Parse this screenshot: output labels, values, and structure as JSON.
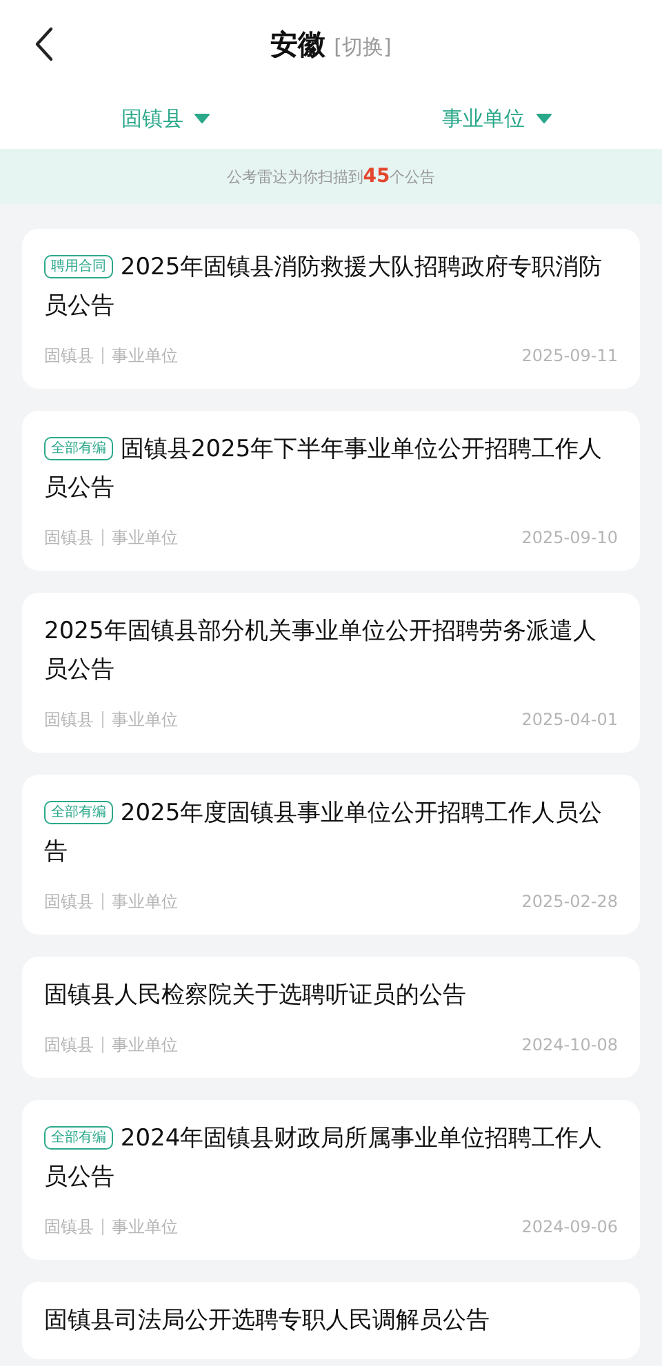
{
  "header": {
    "title": "安徽",
    "switch_label": "[切换]"
  },
  "filters": [
    {
      "label": "固镇县"
    },
    {
      "label": "事业单位"
    }
  ],
  "notice": "公考雷达为你扫描到**45**个公告",
  "announcements": [
    {
      "tag": "聘用合同",
      "title": "2025年固镇县消防救援大队招聘政府专职消防员公告",
      "region": "固镇县",
      "category": "事业单位",
      "date": "2025-09-11"
    },
    {
      "tag": "全部有编",
      "title": "固镇县2025年下半年事业单位公开招聘工作人员公告",
      "region": "固镇县",
      "category": "事业单位",
      "date": "2025-09-10"
    },
    {
      "title": "2025年固镇县部分机关事业单位公开招聘劳务派遣人员公告",
      "region": "固镇县",
      "category": "事业单位",
      "date": "2025-04-01"
    },
    {
      "tag": "全部有编",
      "title": "2025年度固镇县事业单位公开招聘工作人员公告",
      "region": "固镇县",
      "category": "事业单位",
      "date": "2025-02-28"
    },
    {
      "title": "固镇县人民检察院关于选聘听证员的公告",
      "region": "固镇县",
      "category": "事业单位",
      "date": "2024-10-08"
    },
    {
      "tag": "全部有编",
      "title": "2024年固镇县财政局所属事业单位招聘工作人员公告",
      "region": "固镇县",
      "category": "事业单位",
      "date": "2024-09-06"
    },
    {
      "title": "固镇县司法局公开选聘专职人民调解员公告"
    }
  ]
}
